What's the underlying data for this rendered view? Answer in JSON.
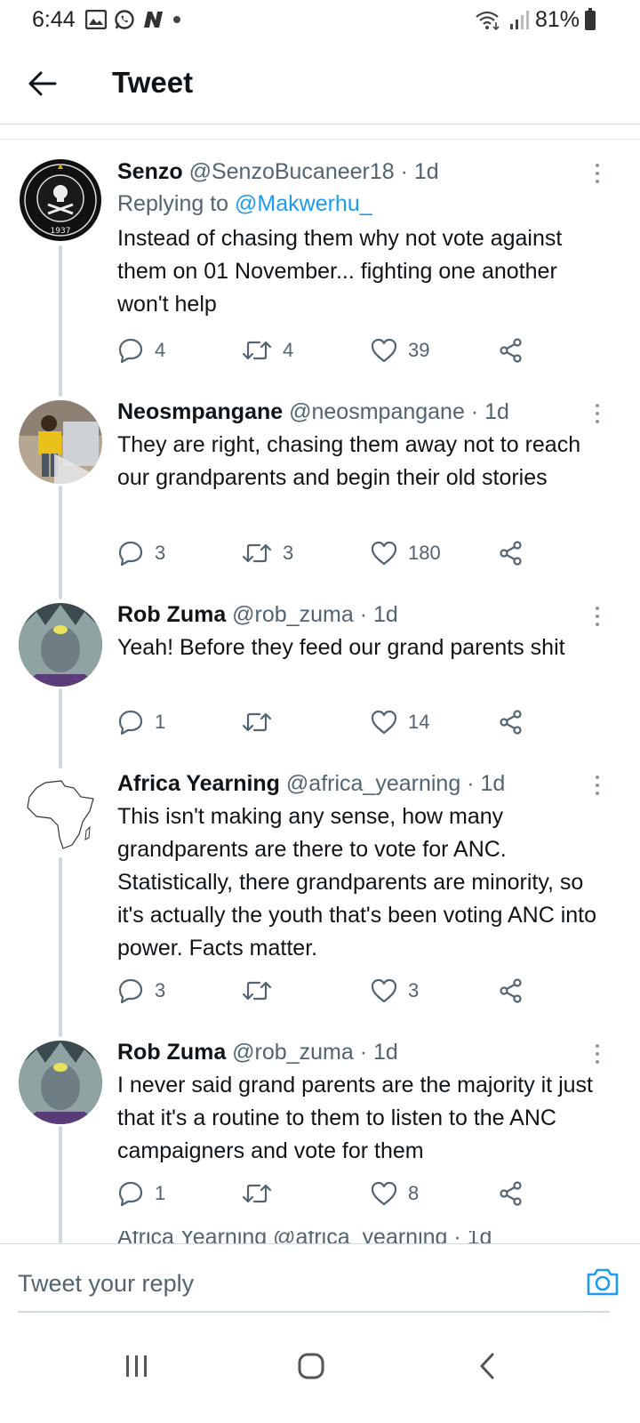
{
  "status_bar": {
    "time": "6:44",
    "battery": "81%"
  },
  "header": {
    "title": "Tweet"
  },
  "tweets": [
    {
      "name": "Senzo",
      "handle": "@SenzoBucaneer18",
      "time": "· 1d",
      "replying_label": "Replying to",
      "replying_handle": "@Makwerhu_",
      "text": "Instead of chasing them why not vote against them on 01 November... fighting one another won't help",
      "replies": "4",
      "retweets": "4",
      "likes": "39",
      "avatar": "orlando-pirates-logo"
    },
    {
      "name": "Neosmpangane",
      "handle": "@neosmpangane",
      "time": "· 1d",
      "text": "They are right, chasing them away not to reach our grandparents and begin their old stories",
      "replies": "3",
      "retweets": "3",
      "likes": "180",
      "avatar": "photo-person-yellow-shirt"
    },
    {
      "name": "Rob Zuma",
      "handle": "@rob_zuma",
      "time": "· 1d",
      "text": "Yeah! Before they feed our grand parents shit",
      "replies": "1",
      "retweets": "",
      "likes": "14",
      "avatar": "anime-character"
    },
    {
      "name": "Africa Yearning",
      "handle": "@africa_yearning",
      "time": "· 1d",
      "text": "This isn't making any sense, how many grandparents are there to vote for ANC. Statistically, there grandparents are minority, so it's actually the youth that's been voting ANC into power. Facts matter.",
      "replies": "3",
      "retweets": "",
      "likes": "3",
      "avatar": "africa-outline"
    },
    {
      "name": "Rob Zuma",
      "handle": "@rob_zuma",
      "time": "· 1d",
      "text": "I never said grand parents are the majority it just that it's a  routine to them to listen to the ANC campaigners and vote for them",
      "replies": "1",
      "retweets": "",
      "likes": "8",
      "avatar": "anime-character"
    }
  ],
  "partial_next": {
    "text": "Africa Yearning @africa_yearning · 1d"
  },
  "reply_bar": {
    "placeholder": "Tweet your reply"
  },
  "colors": {
    "link": "#1d9bf0",
    "secondary_text": "#536471",
    "thread_line": "#cfd9de"
  }
}
